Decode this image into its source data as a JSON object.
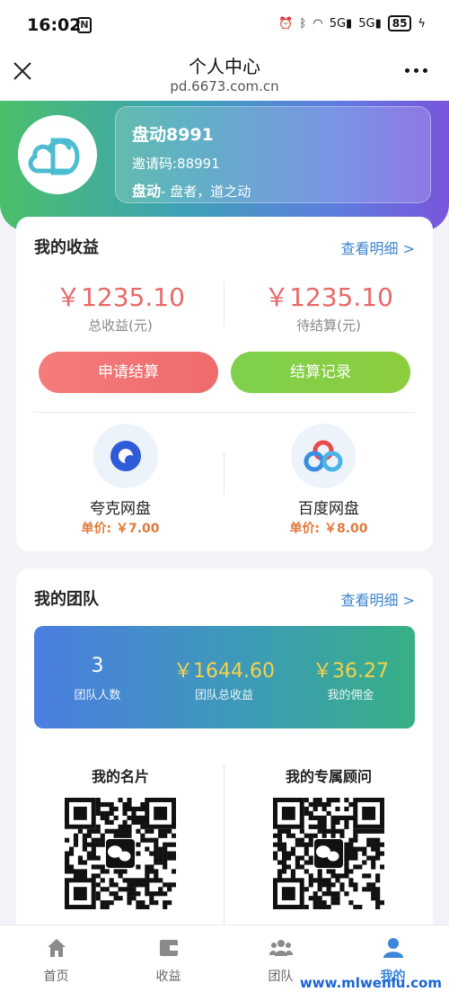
{
  "status_bar": {
    "time": "16:02",
    "nfc_label": "N",
    "signal_1": "5G",
    "signal_2": "5G",
    "battery": "85"
  },
  "header": {
    "title": "个人中心",
    "url": "pd.6673.com.cn"
  },
  "profile": {
    "name": "盘动8991",
    "invite_code": "邀请码:88991",
    "slogan_brand": "盘动",
    "slogan_text": "- 盘者，道之动"
  },
  "earnings": {
    "title": "我的收益",
    "detail_link": "查看明细 >",
    "total_amount": "￥1235.10",
    "total_label": "总收益(元)",
    "pending_amount": "￥1235.10",
    "pending_label": "待结算(元)",
    "apply_button": "申请结算",
    "record_button": "结算记录",
    "disks": [
      {
        "name": "夸克网盘",
        "price": "单价: ￥7.00",
        "icon": "quark-icon"
      },
      {
        "name": "百度网盘",
        "price": "单价: ￥8.00",
        "icon": "baidu-icon"
      }
    ]
  },
  "team": {
    "title": "我的团队",
    "detail_link": "查看明细 >",
    "stats": [
      {
        "value": "3",
        "label": "团队人数"
      },
      {
        "value": "￥1644.60",
        "label": "团队总收益"
      },
      {
        "value": "￥36.27",
        "label": "我的佣金"
      }
    ],
    "qr": [
      {
        "title": "我的名片"
      },
      {
        "title": "我的专属顾问"
      }
    ]
  },
  "nav": {
    "items": [
      {
        "label": "首页",
        "icon": "home-icon"
      },
      {
        "label": "收益",
        "icon": "wallet-icon"
      },
      {
        "label": "团队",
        "icon": "team-icon"
      },
      {
        "label": "我的",
        "icon": "user-icon"
      }
    ]
  },
  "watermark": "www.mlwenlu.com",
  "colors": {
    "accent_red": "#e8696a",
    "accent_blue": "#3e86ce",
    "stat_gold": "#f6d24a",
    "nav_active": "#3c86d8"
  }
}
